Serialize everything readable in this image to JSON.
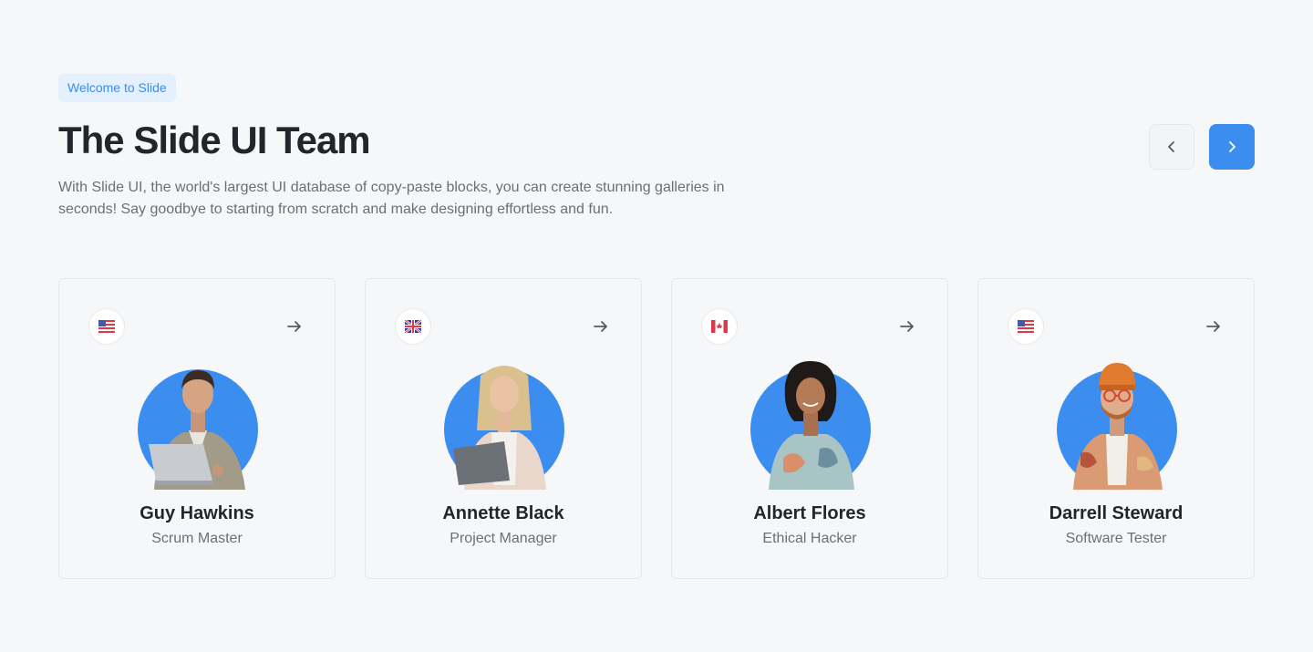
{
  "badge": "Welcome to Slide",
  "title": "The Slide UI Team",
  "description": "With Slide UI, the world's largest UI database of copy-paste blocks, you can create stunning galleries in seconds! Say goodbye to starting from scratch and make designing effortless and fun.",
  "nav": {
    "prev_icon": "chevron-left-icon",
    "next_icon": "chevron-right-icon"
  },
  "colors": {
    "accent": "#3b8ef0",
    "badge_bg": "#e4f0fd",
    "background": "#f6f7f9"
  },
  "members": [
    {
      "name": "Guy Hawkins",
      "role": "Scrum Master",
      "flag": "us-flag-icon"
    },
    {
      "name": "Annette Black",
      "role": "Project Manager",
      "flag": "uk-flag-icon"
    },
    {
      "name": "Albert Flores",
      "role": "Ethical Hacker",
      "flag": "ca-flag-icon"
    },
    {
      "name": "Darrell Steward",
      "role": "Software Tester",
      "flag": "us-flag-icon"
    }
  ]
}
